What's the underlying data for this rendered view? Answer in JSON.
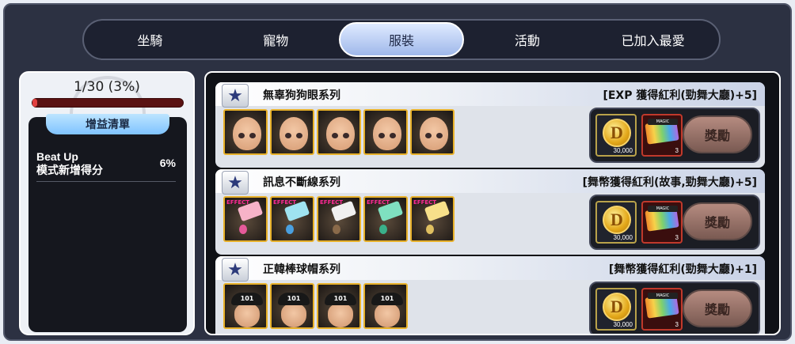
{
  "tabs": [
    {
      "label": "坐騎",
      "active": false
    },
    {
      "label": "寵物",
      "active": false
    },
    {
      "label": "服裝",
      "active": true
    },
    {
      "label": "活動",
      "active": false
    },
    {
      "label": "已加入最愛",
      "active": false
    }
  ],
  "progress": {
    "text": "1/30 (3%)",
    "fraction": 0.033
  },
  "bonus": {
    "header": "增益清單",
    "rows": [
      {
        "label_line1": "Beat Up",
        "label_line2": "模式新增得分",
        "value": "6%"
      }
    ]
  },
  "collections": [
    {
      "title": "無辜狗狗眼系列",
      "reward_text": "[EXP 獲得紅利(勁舞大廳)+5]",
      "item_type": "face",
      "item_count": 5,
      "coin_qty": "30,000",
      "ticket_qty": "3",
      "claim_label": "獎勵"
    },
    {
      "title": "訊息不斷線系列",
      "reward_text": "[舞幣獲得紅利(故事,勁舞大廳)+5]",
      "item_type": "phone",
      "item_count": 5,
      "item_effect_label": "EFFECT",
      "coin_qty": "30,000",
      "ticket_qty": "3",
      "claim_label": "獎勵"
    },
    {
      "title": "正韓棒球帽系列",
      "reward_text": "[舞幣獲得紅利(勁舞大廳)+1]",
      "item_type": "cap",
      "item_count": 4,
      "cap_text": "101",
      "coin_qty": "30,000",
      "ticket_qty": "3",
      "claim_label": "獎勵"
    }
  ],
  "icons": {
    "star": "star-icon",
    "coin": "coin-icon",
    "ticket": "ticket-icon",
    "coin_letter": "D",
    "ticket_label": "MAGIC"
  },
  "colors": {
    "accent_tab": "#9fb8ea",
    "item_border": "#e8b12a",
    "progress_fill": "#e24040",
    "claim_button": "#9b746a"
  }
}
